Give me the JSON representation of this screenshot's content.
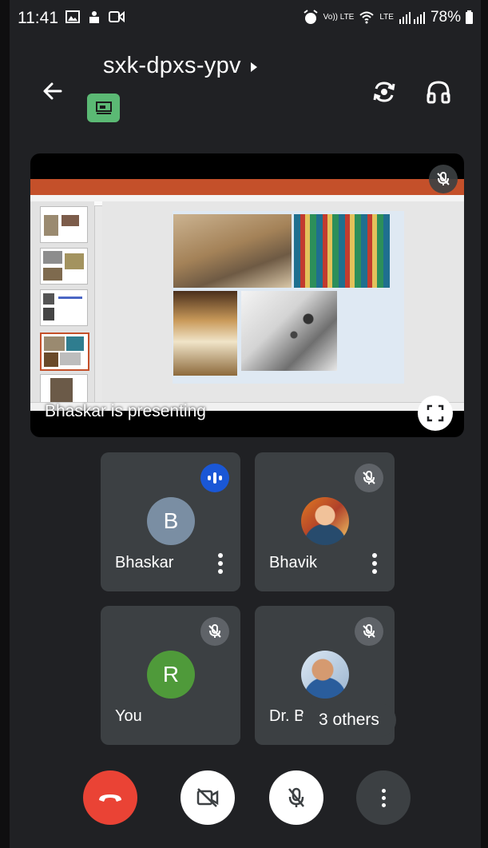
{
  "status_bar": {
    "time": "11:41",
    "network_labels": "Vo)) LTE",
    "lte": "LTE",
    "battery": "78%"
  },
  "header": {
    "meeting_code": "sxk-dpxs-ypv"
  },
  "presentation": {
    "presenter_label": "Bhaskar is presenting"
  },
  "participants": [
    {
      "name": "Bhaskar",
      "initial": "B",
      "avatar_color": "#7a8ea3",
      "state": "speaking"
    },
    {
      "name": "Bhavik",
      "initial": "",
      "avatar_color": "",
      "state": "muted"
    },
    {
      "name": "You",
      "initial": "R",
      "avatar_color": "#4f9a3a",
      "state": "muted"
    },
    {
      "name": "Dr. B M",
      "initial": "",
      "avatar_color": "",
      "state": "muted"
    }
  ],
  "others_label": "3 others",
  "colors": {
    "end_call": "#ea4335",
    "speaking": "#1a57d6",
    "background": "#202124",
    "tile": "#3c4043",
    "cast_badge": "#5bb974"
  },
  "icons": {
    "back": "arrow-left",
    "switch_camera": "camera-flip",
    "audio_output": "headphones",
    "end_call": "phone-hangup",
    "camera": "camera-off",
    "mic": "mic-off",
    "more": "more-vert",
    "fullscreen": "fullscreen"
  }
}
